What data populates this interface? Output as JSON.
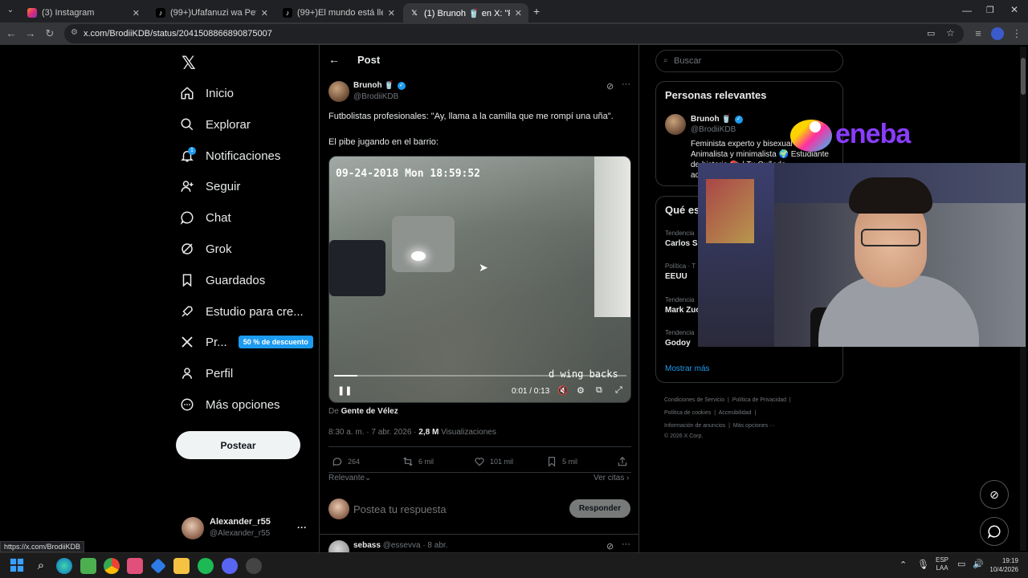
{
  "browser": {
    "tabs": [
      {
        "label": "(3) Instagram",
        "icon": "instagram-icon"
      },
      {
        "label": "(99+)Ufafanuzi wa Pete za Baha",
        "icon": "tiktok-icon"
      },
      {
        "label": "(99+)El mundo está lleno de ge",
        "icon": "tiktok-icon"
      },
      {
        "label": "(1) Brunoh 🥤 en X: \"Futbolistas",
        "icon": "x-icon"
      }
    ],
    "new_tab": "+",
    "url": "x.com/BrodiiKDB/status/2041508866890875007",
    "status_url": "https://x.com/BrodiiKDB"
  },
  "nav": {
    "items": [
      {
        "label": "Inicio",
        "icon": "home-icon"
      },
      {
        "label": "Explorar",
        "icon": "search-icon"
      },
      {
        "label": "Notificaciones",
        "icon": "bell-icon",
        "badge": "1"
      },
      {
        "label": "Seguir",
        "icon": "person-add-icon"
      },
      {
        "label": "Chat",
        "icon": "chat-icon"
      },
      {
        "label": "Grok",
        "icon": "grok-icon"
      },
      {
        "label": "Guardados",
        "icon": "bookmark-icon"
      },
      {
        "label": "Estudio para cre...",
        "icon": "rocket-icon"
      },
      {
        "label": "Pr...",
        "icon": "x-icon",
        "promo": "50 % de descuento"
      },
      {
        "label": "Perfil",
        "icon": "person-icon"
      },
      {
        "label": "Más opciones",
        "icon": "more-circle-icon"
      }
    ],
    "post_button": "Postear",
    "account": {
      "name": "Alexander_r55",
      "handle": "@Alexander_r55",
      "more": "···"
    }
  },
  "post": {
    "header": "Post",
    "author": {
      "name": "Brunoh 🥤",
      "handle": "@BrodiiKDB"
    },
    "text_line1": "Futbolistas profesionales: \"Ay, llama a la camilla que me rompí una uña\".",
    "text_line2": "El pibe jugando en el barrio:",
    "video": {
      "timestamp_overlay": "09-24-2018 Mon 18:59:52",
      "corner_text": "d wing backs",
      "time": "0:01 / 0:13",
      "progress": 0.08
    },
    "source_prefix": "De",
    "source": "Gente de Vélez",
    "meta_time": "8:30 a. m. · 7 abr. 2026 · ",
    "views_count": "2,8 M",
    "views_label": "Visualizaciones",
    "stats": {
      "replies": "264",
      "reposts": "6 mil",
      "likes": "101 mil",
      "bookmarks": "5 mil"
    },
    "sort_label": "Relevante",
    "quotes_link": "Ver citas",
    "reply_placeholder": "Postea tu respuesta",
    "reply_button": "Responder",
    "next_reply": {
      "name": "sebass",
      "handle": "@essevva",
      "date": "· 8 abr."
    }
  },
  "sidebar": {
    "search_placeholder": "Buscar",
    "relevant_title": "Personas relevantes",
    "relevant_person": {
      "name": "Brunoh 🥤",
      "handle": "@BrodiiKDB",
      "bio_line1": "Feminista experto y bisexual",
      "bio_line2": "Animalista y minimalista 🌍 Estudiante",
      "bio_line3": "de historia 📚 | Tu Cuñado",
      "bio_line4": "ac"
    },
    "trends_title": "Qué es",
    "trends": [
      {
        "context": "Tendencia",
        "name": "Carlos Sa"
      },
      {
        "context": "Política · T",
        "name": "EEUU"
      },
      {
        "context": "Tendencia",
        "name": "Mark Zuc"
      },
      {
        "context": "Tendencia",
        "name": "Godoy"
      }
    ],
    "show_more": "Mostrar más",
    "footer": [
      "Condiciones de Servicio",
      "Política de Privacidad",
      "Política de cookies",
      "Accesibilidad",
      "Información de anuncios",
      "Más opciones ···",
      "© 2026 X Corp."
    ]
  },
  "overlay": {
    "brand": "eneba"
  },
  "taskbar": {
    "lang_line1": "ESP",
    "lang_line2": "LAA",
    "time": "19:19",
    "date": "10/4/2026"
  },
  "colors": {
    "accent": "#1d9bf0",
    "background": "#000000",
    "border": "#2f3336",
    "muted": "#71767b"
  }
}
